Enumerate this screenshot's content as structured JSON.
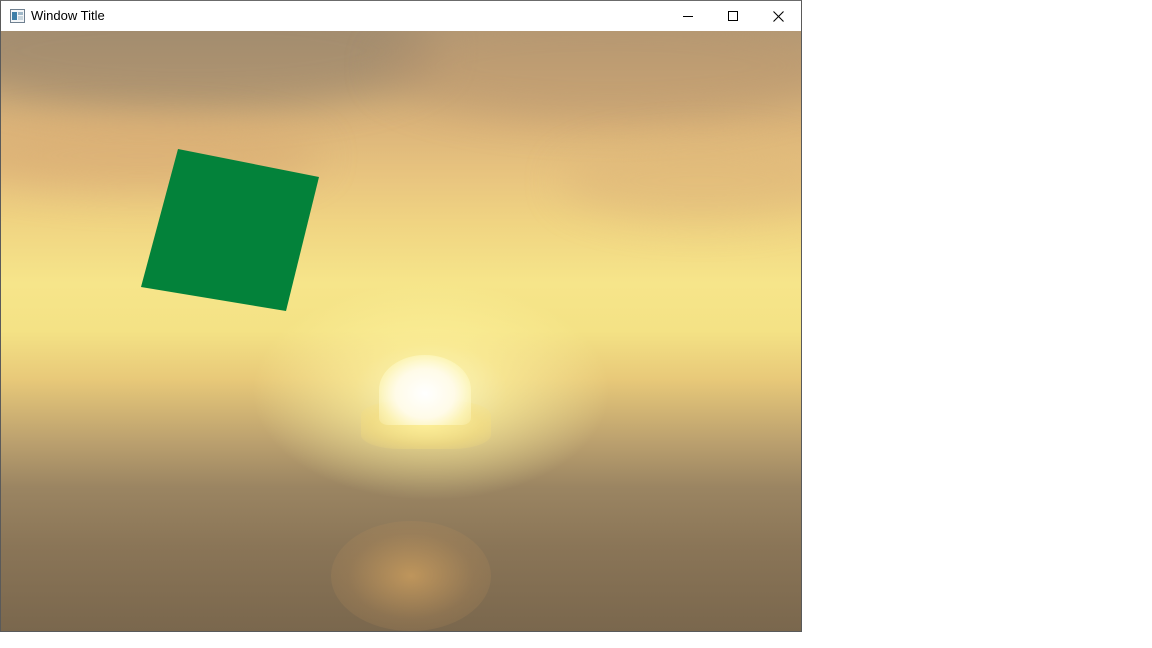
{
  "window": {
    "title": "Window Title",
    "icon": "app-window-icon",
    "controls": {
      "minimize_icon": "minimize-icon",
      "maximize_icon": "maximize-icon",
      "close_icon": "close-icon"
    }
  },
  "scene": {
    "background": "sunset-skybox",
    "quad_color": "#03823a"
  }
}
